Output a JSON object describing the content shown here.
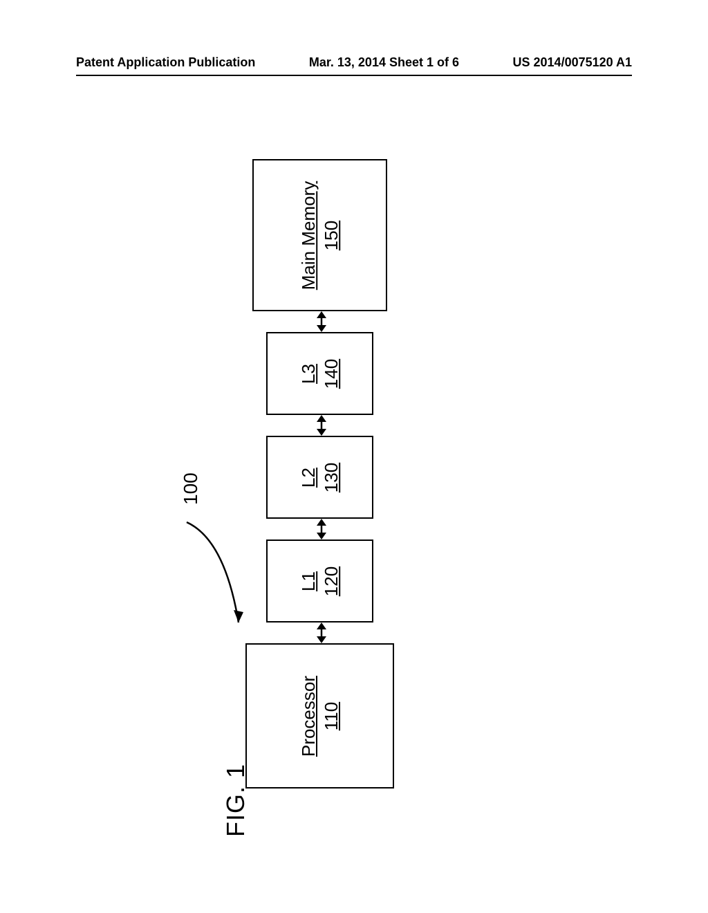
{
  "header": {
    "left": "Patent Application Publication",
    "center": "Mar. 13, 2014  Sheet 1 of 6",
    "right": "US 2014/0075120 A1"
  },
  "diagram": {
    "reference": "100",
    "figure_label": "FIG. 1",
    "blocks": {
      "processor": {
        "name": "Processor",
        "num": "110"
      },
      "l1": {
        "name": "L1",
        "num": "120"
      },
      "l2": {
        "name": "L2",
        "num": "130"
      },
      "l3": {
        "name": "L3",
        "num": "140"
      },
      "mem": {
        "name": "Main Memory",
        "num": "150"
      }
    }
  }
}
